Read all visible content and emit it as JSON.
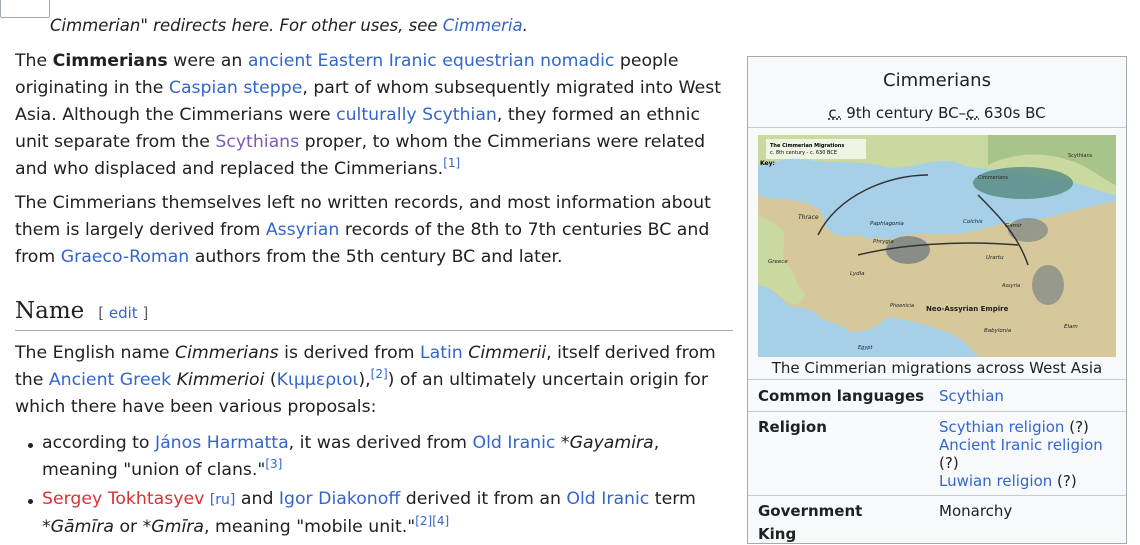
{
  "hatnote": {
    "text": "Cimmerian\" redirects here. For other uses, see ",
    "link": "Cimmeria",
    "end": "."
  },
  "intro": {
    "p1": {
      "t1": "The ",
      "bold": "Cimmerians",
      "t2": " were an ",
      "l1": "ancient Eastern Iranic equestrian nomadic",
      "t3": " people originating in the ",
      "l2": "Caspian steppe",
      "t4": ", part of whom subsequently migrated into West Asia. Although the Cimmerians were ",
      "l3": "culturally Scythian",
      "t5": ", they formed an ethnic unit separate from the ",
      "l4": "Scythians",
      "t6": " proper, to whom the Cimmerians were related and who displaced and replaced the Cimmerians.",
      "ref": "[1]"
    },
    "p2": {
      "t1": "The Cimmerians themselves left no written records, and most information about them is largely derived from ",
      "l1": "Assyrian",
      "t2": " records of the 8th to 7th centuries BC and from ",
      "l2": "Graeco-Roman",
      "t3": " authors from the 5th century BC and later."
    }
  },
  "section": {
    "heading": "Name",
    "edit_open": "[ ",
    "edit": "edit",
    "edit_close": " ]"
  },
  "name_para": {
    "t1": "The English name ",
    "i1": "Cimmerians",
    "t2": " is derived from ",
    "l1": "Latin",
    "t3": " ",
    "i2": "Cimmerii",
    "t4": ", itself derived from the ",
    "l2": "Ancient Greek",
    "t5": " ",
    "i3": "Kimmerioi",
    "t6": " (",
    "l3": "Κιμμεριοι",
    "t7": "),",
    "ref": "[2]",
    "t8": ") of an ultimately uncertain origin for which there have been various proposals:"
  },
  "bullets": [
    {
      "t1": "according to ",
      "l1": "János Harmatta",
      "t2": ", it was derived from ",
      "l2": "Old Iranic",
      "t3": " *",
      "i1": "Gayamira",
      "t4": ", meaning \"union of clans.\"",
      "ref": "[3]"
    },
    {
      "l0": "Sergey Tokhtasyev",
      "lang": "[ru]",
      "t1": " and ",
      "l1": "Igor Diakonoff",
      "t2": " derived it from an ",
      "l2": "Old Iranic",
      "t3": " term *",
      "i1": "Gāmīra",
      "t4": " or *",
      "i2": "Gmīra",
      "t5": ", meaning \"mobile unit.\"",
      "ref": "[2][4]"
    }
  ],
  "infobox": {
    "title": "Cimmerians",
    "period_c1": "c.",
    "period_mid": " 9th century BC–",
    "period_c2": "c.",
    "period_end": " 630s BC",
    "map_labels": {
      "title1": "The Cimmerian Migrations",
      "title2": "c. 8th century - c. 630 BCE",
      "key": "Key:",
      "cimmerians": "Cimmerians",
      "scythians": "Scythians",
      "thrace": "Thrace",
      "paphlagonia": "Paphlagonia",
      "phrygia": "Phrygia",
      "colchis": "Colchis",
      "gamir": "Gamir",
      "lydia": "Lydia",
      "urartu": "Urartu",
      "greece": "Greece",
      "assyria": "Assyria",
      "neo_assyrian": "Neo-Assyrian Empire",
      "phoenicia": "Phoenicia",
      "babylonia": "Babylonia",
      "elam": "Elam",
      "egypt": "Egypt"
    },
    "caption": "The Cimmerian migrations across West Asia",
    "rows": [
      {
        "label": "Common languages",
        "value": "Scythian"
      },
      {
        "label": "Religion",
        "v1": "Scythian religion",
        "q1": " (?)",
        "v2": "Ancient Iranic religion",
        "q2": "(?)",
        "v3": "Luwian religion",
        "q3": " (?)"
      },
      {
        "label": "Government",
        "value": "Monarchy"
      },
      {
        "label": "King",
        "value": ""
      }
    ]
  },
  "colors": {
    "link": "#3366cc",
    "visited": "#795cb2",
    "redlink": "#d73333",
    "text": "#202122",
    "infobox_bg": "#f8f9fa",
    "border": "#a2a9b1"
  }
}
